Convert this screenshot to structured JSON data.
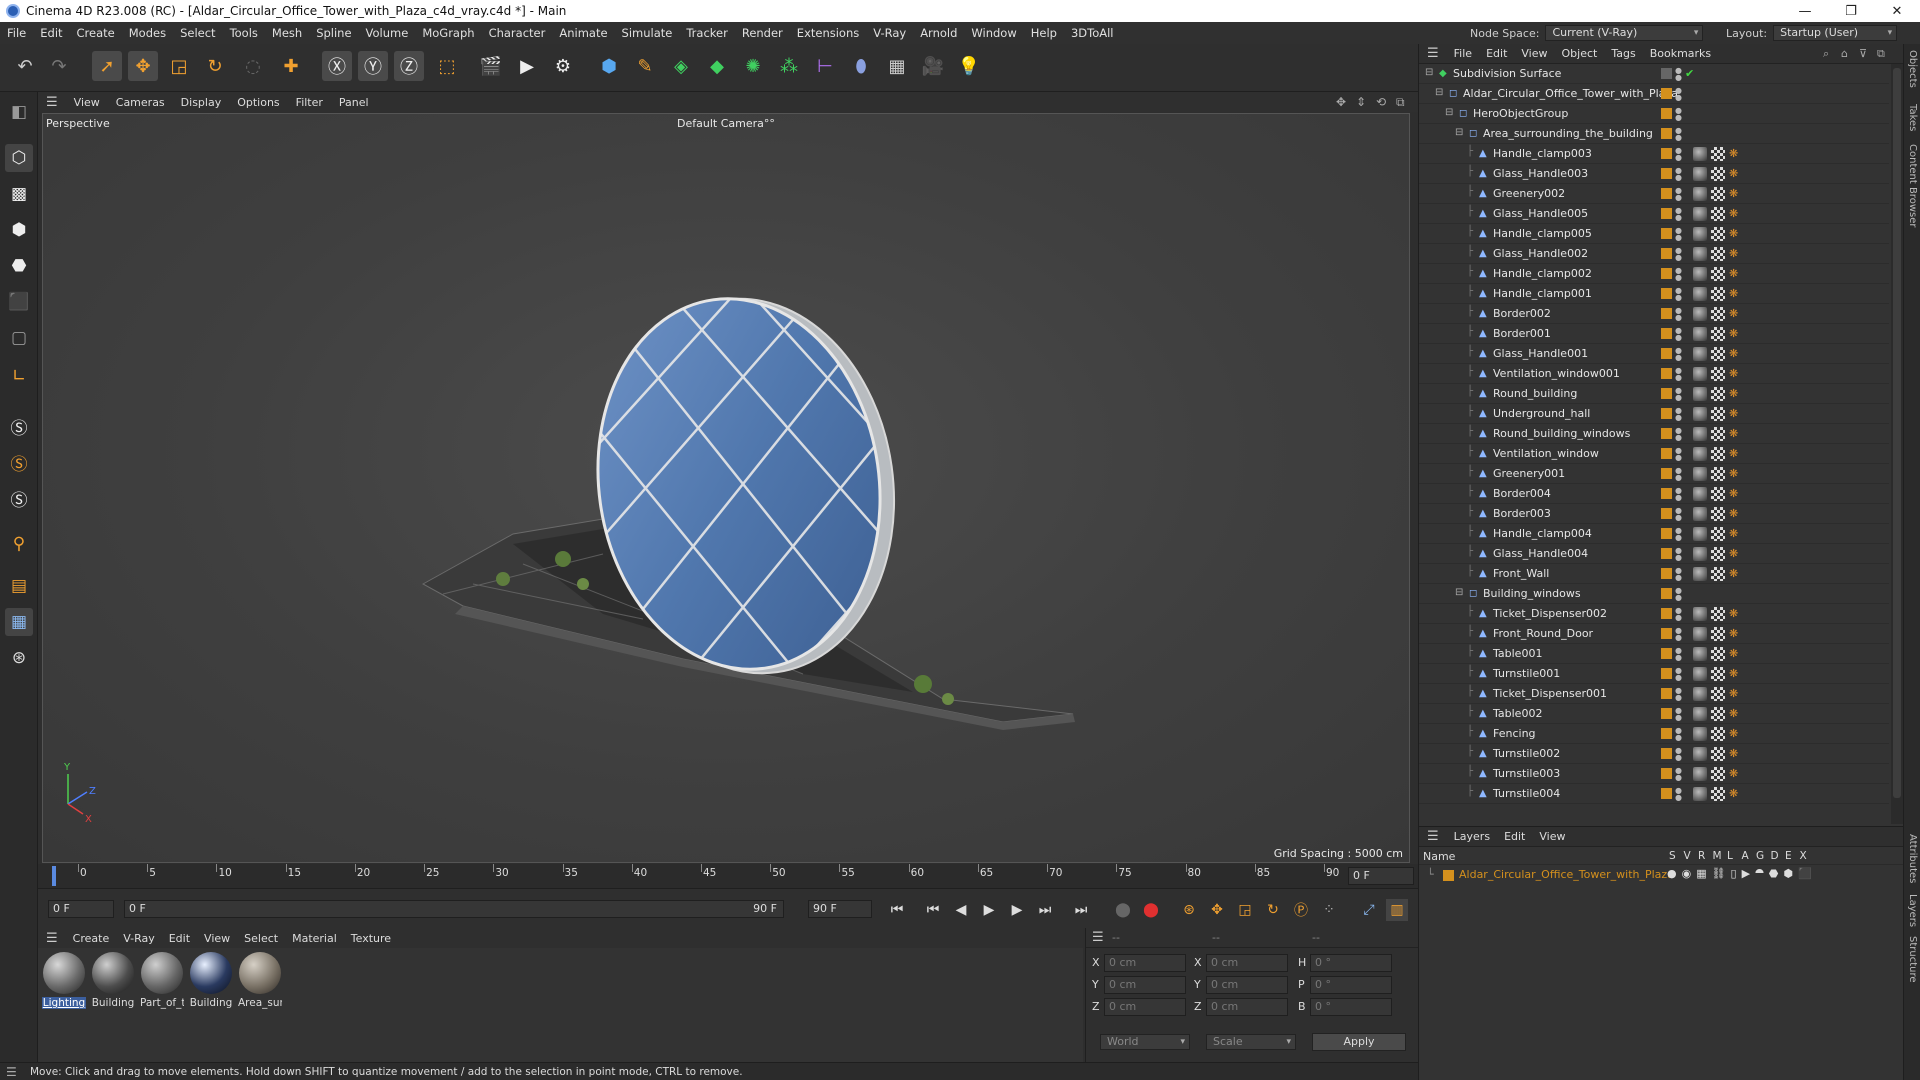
{
  "window": {
    "title": "Cinema 4D R23.008 (RC) - [Aldar_Circular_Office_Tower_with_Plaza_c4d_vray.c4d *] - Main",
    "minimize": "—",
    "maximize": "❐",
    "close": "✕"
  },
  "menubar": {
    "items": [
      "File",
      "Edit",
      "Create",
      "Modes",
      "Select",
      "Tools",
      "Mesh",
      "Spline",
      "Volume",
      "MoGraph",
      "Character",
      "Animate",
      "Simulate",
      "Tracker",
      "Render",
      "Extensions",
      "V-Ray",
      "Arnold",
      "Window",
      "Help",
      "3DToAll"
    ],
    "node_space_label": "Node Space:",
    "node_space_value": "Current (V-Ray)",
    "layout_label": "Layout:",
    "layout_value": "Startup (User)"
  },
  "viewport": {
    "menu": [
      "View",
      "Cameras",
      "Display",
      "Options",
      "Filter",
      "Panel"
    ],
    "label": "Perspective",
    "camera": "Default Camera",
    "camera_mark": "°°",
    "grid_spacing": "Grid Spacing : 5000 cm",
    "axis_y": "Y",
    "axis_z": "Z",
    "axis_x": "X"
  },
  "timeline": {
    "ticks": [
      "0",
      "5",
      "10",
      "15",
      "20",
      "25",
      "30",
      "35",
      "40",
      "45",
      "50",
      "55",
      "60",
      "65",
      "70",
      "75",
      "80",
      "85",
      "90"
    ],
    "end_field": "0 F"
  },
  "transport": {
    "current_frame": "0 F",
    "range_start": "0 F",
    "range_end": "90 F",
    "max_frame": "90 F"
  },
  "materials": {
    "menu": [
      "Create",
      "V-Ray",
      "Edit",
      "View",
      "Select",
      "Material",
      "Texture"
    ],
    "items": [
      "Lighting",
      "Building",
      "Part_of_t",
      "Building",
      "Area_sur"
    ]
  },
  "coords": {
    "headers": [
      "--",
      "--",
      "--"
    ],
    "rows": [
      {
        "a_label": "X",
        "a_value": "0 cm",
        "b_label": "X",
        "b_value": "0 cm",
        "c_label": "H",
        "c_value": "0 °"
      },
      {
        "a_label": "Y",
        "a_value": "0 cm",
        "b_label": "Y",
        "b_value": "0 cm",
        "c_label": "P",
        "c_value": "0 °"
      },
      {
        "a_label": "Z",
        "a_value": "0 cm",
        "b_label": "Z",
        "b_value": "0 cm",
        "c_label": "B",
        "c_value": "0 °"
      }
    ],
    "world": "World",
    "scale": "Scale",
    "apply": "Apply"
  },
  "status": "Move: Click and drag to move elements. Hold down SHIFT to quantize movement / add to the selection in point mode, CTRL to remove.",
  "objects": {
    "menu": [
      "File",
      "Edit",
      "View",
      "Object",
      "Tags",
      "Bookmarks"
    ],
    "rows": [
      {
        "name": "Subdivision Surface",
        "depth": 0,
        "group": true,
        "check": true,
        "tags": 0
      },
      {
        "name": "Aldar_Circular_Office_Tower_with_Plaza",
        "depth": 1,
        "group": true,
        "tags": 0
      },
      {
        "name": "HeroObjectGroup",
        "depth": 2,
        "group": true,
        "tags": 0
      },
      {
        "name": "Area_surrounding_the_building",
        "depth": 3,
        "group": true,
        "tags": 0
      },
      {
        "name": "Handle_clamp003",
        "depth": 4,
        "tags": 3
      },
      {
        "name": "Glass_Handle003",
        "depth": 4,
        "tags": 3
      },
      {
        "name": "Greenery002",
        "depth": 4,
        "tags": 3
      },
      {
        "name": "Glass_Handle005",
        "depth": 4,
        "tags": 3
      },
      {
        "name": "Handle_clamp005",
        "depth": 4,
        "tags": 3
      },
      {
        "name": "Glass_Handle002",
        "depth": 4,
        "tags": 3
      },
      {
        "name": "Handle_clamp002",
        "depth": 4,
        "tags": 3
      },
      {
        "name": "Handle_clamp001",
        "depth": 4,
        "tags": 3
      },
      {
        "name": "Border002",
        "depth": 4,
        "tags": 3
      },
      {
        "name": "Border001",
        "depth": 4,
        "tags": 3
      },
      {
        "name": "Glass_Handle001",
        "depth": 4,
        "tags": 3
      },
      {
        "name": "Ventilation_window001",
        "depth": 4,
        "tags": 3
      },
      {
        "name": "Round_building",
        "depth": 4,
        "tags": 3
      },
      {
        "name": "Underground_hall",
        "depth": 4,
        "tags": 3
      },
      {
        "name": "Round_building_windows",
        "depth": 4,
        "tags": 3
      },
      {
        "name": "Ventilation_window",
        "depth": 4,
        "tags": 3
      },
      {
        "name": "Greenery001",
        "depth": 4,
        "tags": 3
      },
      {
        "name": "Border004",
        "depth": 4,
        "tags": 3
      },
      {
        "name": "Border003",
        "depth": 4,
        "tags": 3
      },
      {
        "name": "Handle_clamp004",
        "depth": 4,
        "tags": 3
      },
      {
        "name": "Glass_Handle004",
        "depth": 4,
        "tags": 3
      },
      {
        "name": "Front_Wall",
        "depth": 4,
        "tags": 3
      },
      {
        "name": "Building_windows",
        "depth": 3,
        "group": true,
        "tags": 0
      },
      {
        "name": "Ticket_Dispenser002",
        "depth": 4,
        "tags": 3
      },
      {
        "name": "Front_Round_Door",
        "depth": 4,
        "tags": 3
      },
      {
        "name": "Table001",
        "depth": 4,
        "tags": 3
      },
      {
        "name": "Turnstile001",
        "depth": 4,
        "tags": 3
      },
      {
        "name": "Ticket_Dispenser001",
        "depth": 4,
        "tags": 3
      },
      {
        "name": "Table002",
        "depth": 4,
        "tags": 3
      },
      {
        "name": "Fencing",
        "depth": 4,
        "tags": 3
      },
      {
        "name": "Turnstile002",
        "depth": 4,
        "tags": 3
      },
      {
        "name": "Turnstile003",
        "depth": 4,
        "tags": 3
      },
      {
        "name": "Turnstile004",
        "depth": 4,
        "tags": 3
      }
    ]
  },
  "layers": {
    "menu": [
      "Layers",
      "Edit",
      "View"
    ],
    "name_header": "Name",
    "flag_headers": [
      "S",
      "V",
      "R",
      "M",
      "L",
      "A",
      "G",
      "D",
      "E",
      "X"
    ],
    "layer_name": "Aldar_Circular_Office_Tower_with_Plaza",
    "layer_color": "#d4901d"
  },
  "right_tabs": [
    "Objects",
    "Takes",
    "Content Browser",
    "Attributes",
    "Layers",
    "Structure"
  ]
}
